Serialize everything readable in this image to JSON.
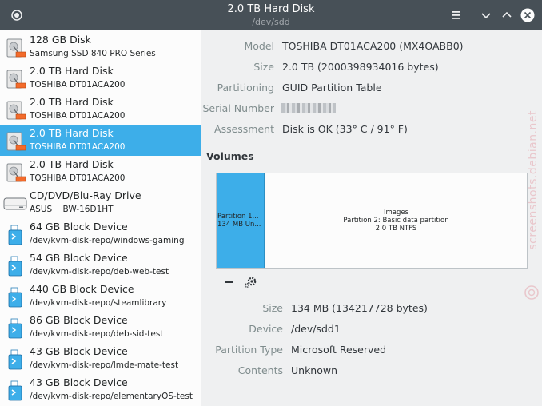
{
  "window": {
    "title": "2.0 TB Hard Disk",
    "subtitle": "/dev/sdd"
  },
  "sidebar": {
    "items": [
      {
        "name": "128 GB Disk",
        "sub": "Samsung SSD 840 PRO Series",
        "icon": "hard-disk-icon",
        "selected": false
      },
      {
        "name": "2.0 TB Hard Disk",
        "sub": "TOSHIBA DT01ACA200",
        "icon": "hard-disk-icon",
        "selected": false
      },
      {
        "name": "2.0 TB Hard Disk",
        "sub": "TOSHIBA DT01ACA200",
        "icon": "hard-disk-icon",
        "selected": false
      },
      {
        "name": "2.0 TB Hard Disk",
        "sub": "TOSHIBA DT01ACA200",
        "icon": "hard-disk-icon",
        "selected": true
      },
      {
        "name": "2.0 TB Hard Disk",
        "sub": "TOSHIBA DT01ACA200",
        "icon": "hard-disk-icon",
        "selected": false
      },
      {
        "name": "CD/DVD/Blu-Ray Drive",
        "sub": "ASUS    BW-16D1HT",
        "icon": "optical-drive-icon",
        "selected": false
      },
      {
        "name": "64 GB Block Device",
        "sub": "/dev/kvm-disk-repo/windows-gaming",
        "icon": "block-device-icon",
        "selected": false
      },
      {
        "name": "54 GB Block Device",
        "sub": "/dev/kvm-disk-repo/deb-web-test",
        "icon": "block-device-icon",
        "selected": false
      },
      {
        "name": "440 GB Block Device",
        "sub": "/dev/kvm-disk-repo/steamlibrary",
        "icon": "block-device-icon",
        "selected": false
      },
      {
        "name": "86 GB Block Device",
        "sub": "/dev/kvm-disk-repo/deb-sid-test",
        "icon": "block-device-icon",
        "selected": false
      },
      {
        "name": "43 GB Block Device",
        "sub": "/dev/kvm-disk-repo/lmde-mate-test",
        "icon": "block-device-icon",
        "selected": false
      },
      {
        "name": "43 GB Block Device",
        "sub": "/dev/kvm-disk-repo/elementaryOS-test",
        "icon": "block-device-icon",
        "selected": false
      }
    ]
  },
  "disk_props": {
    "model_label": "Model",
    "model": "TOSHIBA DT01ACA200 (MX4OABB0)",
    "size_label": "Size",
    "size": "2.0 TB (2000398934016 bytes)",
    "partitioning_label": "Partitioning",
    "partitioning": "GUID Partition Table",
    "serial_label": "Serial Number",
    "assessment_label": "Assessment",
    "assessment": "Disk is OK (33° C / 91° F)"
  },
  "volumes": {
    "heading": "Volumes",
    "part1_line1": "Partition 1...",
    "part1_line2": "134 MB Un...",
    "part2_line1": "Images",
    "part2_line2": "Partition 2: Basic data partition",
    "part2_line3": "2.0 TB NTFS"
  },
  "partition_props": {
    "size_label": "Size",
    "size": "134 MB (134217728 bytes)",
    "device_label": "Device",
    "device": "/dev/sdd1",
    "type_label": "Partition Type",
    "type": "Microsoft Reserved",
    "contents_label": "Contents",
    "contents": "Unknown"
  },
  "watermark": "screenshots.debian.net",
  "colors": {
    "accent": "#3daee9",
    "titlebar": "#475057"
  }
}
